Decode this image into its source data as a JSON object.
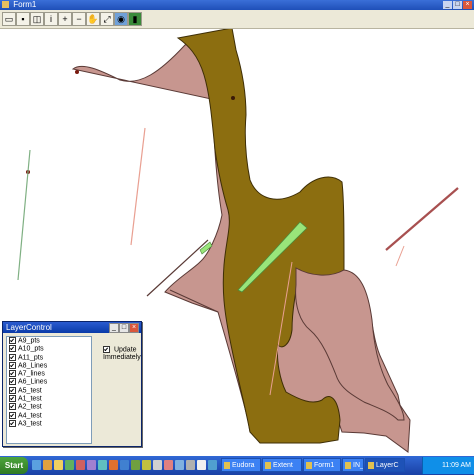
{
  "window": {
    "title": "Form1",
    "title_icon": "app-icon",
    "controls": [
      "minimize-icon",
      "maximize-icon",
      "close-icon"
    ]
  },
  "toolbar": {
    "tools": [
      "open-icon",
      "save-icon",
      "layer-icon",
      "identify-icon",
      "zoom-in-icon",
      "zoom-out-icon",
      "pan-icon",
      "full-extent-icon",
      "globe-icon",
      "select-icon"
    ]
  },
  "map": {
    "colors": {
      "land": "#c7968f",
      "river": "#8c6e10",
      "green_line": "#99e57a",
      "outline": "#5a3a36",
      "thin_line_red": "#e9a092",
      "thin_line_green": "#7fb083"
    }
  },
  "layer_control": {
    "title": "LayerControl",
    "layers": [
      "A9_pts",
      "A10_pts",
      "A11_pts",
      "A8_Lines",
      "A7_lines",
      "A6_Lines",
      "A5_test",
      "A1_test",
      "A2_test",
      "A4_test",
      "A3_test"
    ],
    "update_label": "Update Immediately",
    "update_checked": true
  },
  "taskbar": {
    "start_label": "Start",
    "tasks": [
      "Eudora",
      "Extent",
      "Form1",
      "IN_Les",
      "LayerC"
    ],
    "active_task": "LayerC",
    "clock": "11:09 AM"
  }
}
